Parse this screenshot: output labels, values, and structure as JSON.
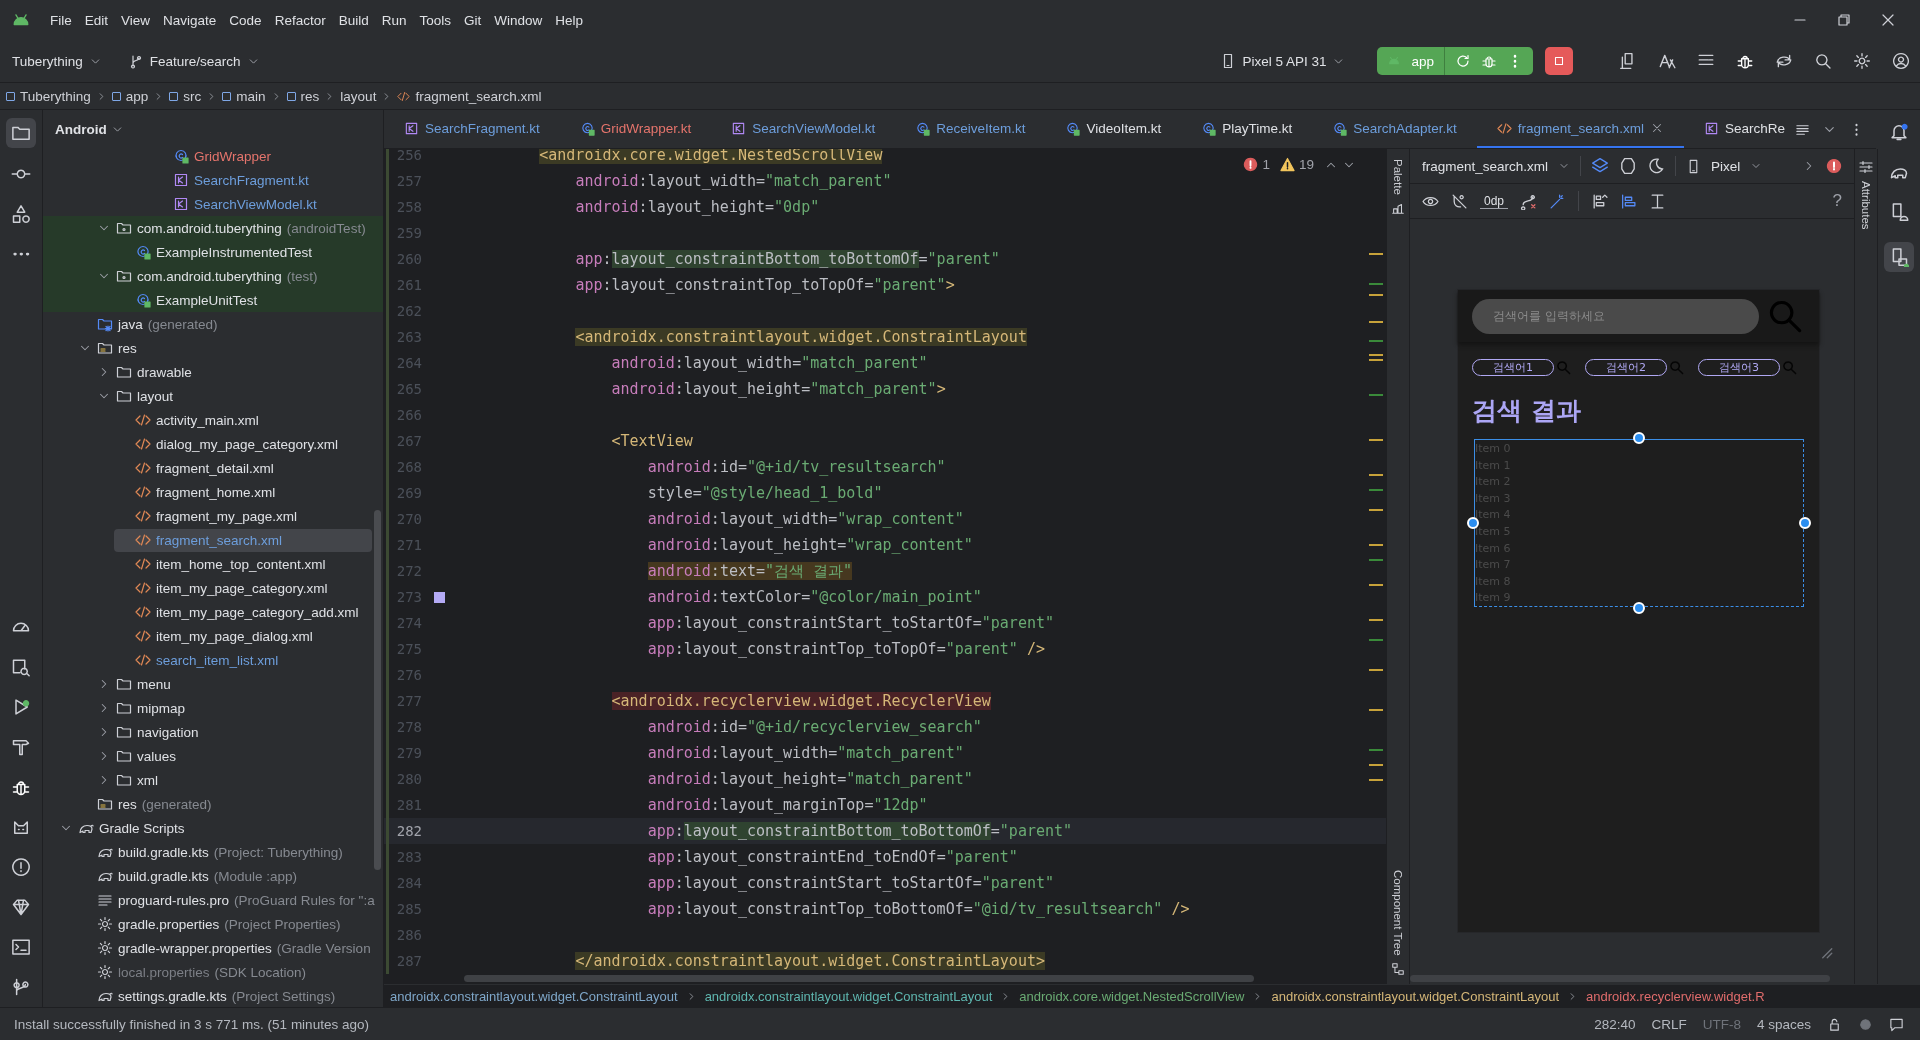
{
  "menu": [
    "File",
    "Edit",
    "View",
    "Navigate",
    "Code",
    "Refactor",
    "Build",
    "Run",
    "Tools",
    "Git",
    "Window",
    "Help"
  ],
  "toolbar": {
    "project": "Tuberything",
    "branch": "Feature/search",
    "device": "Pixel 5 API 31",
    "run_config": "app"
  },
  "breadcrumb": [
    "Tuberything",
    "app",
    "src",
    "main",
    "res",
    "layout",
    "fragment_search.xml"
  ],
  "project_panel": {
    "view": "Android",
    "tree": [
      {
        "children": [
          {
            "children": [
              {
                "children": [
                  {
                    "children": [
                      {
                        "children": [
                          {
                            "label": "GridWrapper",
                            "kind": "class",
                            "color": "#e5746c",
                            "selected": false
                          },
                          {
                            "label": "SearchFragment.kt",
                            "kind": "kotlin",
                            "color": "#6d9edc",
                            "selected": false
                          },
                          {
                            "label": "SearchViewModel.kt",
                            "kind": "kotlin",
                            "color": "#6d9edc",
                            "selected": false
                          }
                        ]
                      }
                    ]
                  }
                ]
              },
              {
                "label": "com.android.tuberything",
                "suffix": "(androidTest)",
                "kind": "package",
                "selected": false,
                "highlighted": true,
                "expanded": true,
                "children": [
                  {
                    "label": "ExampleInstrumentedTest",
                    "kind": "class",
                    "selected": false,
                    "highlighted": true
                  }
                ]
              },
              {
                "label": "com.android.tuberything",
                "suffix": "(test)",
                "kind": "package",
                "selected": false,
                "highlighted": true,
                "expanded": true,
                "children": [
                  {
                    "label": "ExampleUnitTest",
                    "kind": "class",
                    "selected": false,
                    "highlighted": true
                  }
                ]
              }
            ]
          },
          {
            "label": "java",
            "suffix": "(generated)",
            "kind": "gen-folder",
            "selected": false
          },
          {
            "label": "res",
            "kind": "res-folder",
            "selected": false,
            "expanded": true,
            "children": [
              {
                "label": "drawable",
                "kind": "folder",
                "selected": false,
                "expanded": false
              },
              {
                "label": "layout",
                "kind": "folder",
                "selected": false,
                "expanded": true,
                "children": [
                  {
                    "label": "activity_main.xml",
                    "kind": "xml",
                    "selected": false
                  },
                  {
                    "label": "dialog_my_page_category.xml",
                    "kind": "xml",
                    "selected": false
                  },
                  {
                    "label": "fragment_detail.xml",
                    "kind": "xml",
                    "selected": false
                  },
                  {
                    "label": "fragment_home.xml",
                    "kind": "xml",
                    "selected": false
                  },
                  {
                    "label": "fragment_my_page.xml",
                    "kind": "xml",
                    "selected": false
                  },
                  {
                    "label": "fragment_search.xml",
                    "kind": "xml",
                    "color": "#6d9edc",
                    "selected": true
                  },
                  {
                    "label": "item_home_top_content.xml",
                    "kind": "xml",
                    "selected": false
                  },
                  {
                    "label": "item_my_page_category.xml",
                    "kind": "xml",
                    "selected": false
                  },
                  {
                    "label": "item_my_page_category_add.xml",
                    "kind": "xml",
                    "selected": false
                  },
                  {
                    "label": "item_my_page_dialog.xml",
                    "kind": "xml",
                    "selected": false
                  },
                  {
                    "label": "search_item_list.xml",
                    "kind": "xml",
                    "color": "#6d9edc",
                    "selected": false
                  }
                ]
              },
              {
                "label": "menu",
                "kind": "folder",
                "selected": false,
                "expanded": false
              },
              {
                "label": "mipmap",
                "kind": "folder",
                "selected": false,
                "expanded": false
              },
              {
                "label": "navigation",
                "kind": "folder",
                "selected": false,
                "expanded": false
              },
              {
                "label": "values",
                "kind": "folder",
                "selected": false,
                "expanded": false
              },
              {
                "label": "xml",
                "kind": "folder",
                "selected": false,
                "expanded": false
              }
            ]
          },
          {
            "label": "res",
            "suffix": "(generated)",
            "kind": "res-folder",
            "selected": false
          }
        ]
      },
      {
        "label": "Gradle Scripts",
        "kind": "gradle",
        "selected": false,
        "expanded": true,
        "children": [
          {
            "label": "build.gradle.kts",
            "suffix": "(Project: Tuberything)",
            "kind": "gradle",
            "selected": false
          },
          {
            "label": "build.gradle.kts",
            "suffix": "(Module :app)",
            "kind": "gradle",
            "selected": false
          },
          {
            "label": "proguard-rules.pro",
            "suffix": "(ProGuard Rules for \":a",
            "kind": "lines",
            "selected": false
          },
          {
            "label": "gradle.properties",
            "suffix": "(Project Properties)",
            "kind": "gear",
            "selected": false
          },
          {
            "label": "gradle-wrapper.properties",
            "suffix": "(Gradle Version",
            "kind": "gear",
            "selected": false
          },
          {
            "label": "local.properties",
            "suffix": "(SDK Location)",
            "kind": "gear",
            "color": "#7c7f86",
            "selected": false
          },
          {
            "label": "settings.gradle.kts",
            "suffix": "(Project Settings)",
            "kind": "gradle",
            "selected": false
          }
        ]
      }
    ]
  },
  "editor_tabs": [
    {
      "label": "SearchFragment.kt",
      "kind": "kotlin",
      "color": "#6d9edc",
      "selected": false
    },
    {
      "label": "GridWrapper.kt",
      "kind": "class",
      "color": "#e5746c",
      "selected": false
    },
    {
      "label": "SearchViewModel.kt",
      "kind": "kotlin",
      "color": "#6d9edc",
      "selected": false
    },
    {
      "label": "ReceiveItem.kt",
      "kind": "class",
      "color": "#6d9edc",
      "selected": false
    },
    {
      "label": "VideoItem.kt",
      "kind": "class",
      "color": "#dfe1e5",
      "selected": false
    },
    {
      "label": "PlayTime.kt",
      "kind": "class",
      "color": "#dfe1e5",
      "selected": false
    },
    {
      "label": "SearchAdapter.kt",
      "kind": "class",
      "color": "#6d9edc",
      "selected": false
    },
    {
      "label": "fragment_search.xml",
      "kind": "xml",
      "color": "#6d9edc",
      "selected": true
    },
    {
      "label": "SearchRe",
      "kind": "kotlin",
      "color": "#dfe1e5",
      "selected": false
    }
  ],
  "inspections": {
    "errors": "1",
    "warnings": "19"
  },
  "code_lines": [
    {
      "n": "256",
      "code": "        <androidx.core.widget.NestedScrollView",
      "kind": "tag-warning",
      "selected": false
    },
    {
      "n": "257",
      "code": "            android:layout_width=\"match_parent\"",
      "kind": "plain",
      "selected": false
    },
    {
      "n": "258",
      "code": "            android:layout_height=\"0dp\"",
      "kind": "plain",
      "selected": false
    },
    {
      "n": "259",
      "selected": false
    },
    {
      "n": "260",
      "code": "            app:layout_constraintBottom_toBottomOf=\"parent\"",
      "kind": "usage",
      "selected": false
    },
    {
      "n": "261",
      "code": "            app:layout_constraintTop_toTopOf=\"parent\">",
      "kind": "plain",
      "selected": false
    },
    {
      "n": "262",
      "selected": false
    },
    {
      "n": "263",
      "code": "            <androidx.constraintlayout.widget.ConstraintLayout",
      "kind": "tag-warning",
      "selected": false
    },
    {
      "n": "264",
      "code": "                android:layout_width=\"match_parent\"",
      "kind": "plain",
      "selected": false
    },
    {
      "n": "265",
      "code": "                android:layout_height=\"match_parent\">",
      "kind": "plain",
      "selected": false
    },
    {
      "n": "266",
      "selected": false
    },
    {
      "n": "267",
      "code": "                <TextView",
      "kind": "plain",
      "selected": false
    },
    {
      "n": "268",
      "code": "                    android:id=\"@+id/tv_resultsearch\"",
      "kind": "plain",
      "selected": false
    },
    {
      "n": "269",
      "code": "                    style=\"@style/head_1_bold\"",
      "kind": "plain",
      "selected": false
    },
    {
      "n": "270",
      "code": "                    android:layout_width=\"wrap_content\"",
      "kind": "plain",
      "selected": false
    },
    {
      "n": "271",
      "code": "                    android:layout_height=\"wrap_content\"",
      "kind": "plain",
      "selected": false
    },
    {
      "n": "272",
      "code": "                    android:text=\"검색 결과\"",
      "kind": "text-warning",
      "selected": false
    },
    {
      "n": "273",
      "code": "                    android:textColor=\"@color/main_point\"",
      "kind": "plain",
      "selected": false,
      "color": "#b4aaf5"
    },
    {
      "n": "274",
      "code": "                    app:layout_constraintStart_toStartOf=\"parent\"",
      "kind": "plain",
      "selected": false
    },
    {
      "n": "275",
      "code": "                    app:layout_constraintTop_toTopOf=\"parent\" />",
      "kind": "plain",
      "selected": false
    },
    {
      "n": "276",
      "selected": false
    },
    {
      "n": "277",
      "code": "                <androidx.recyclerview.widget.RecyclerView",
      "kind": "tag-error",
      "selected": false
    },
    {
      "n": "278",
      "code": "                    android:id=\"@+id/recyclerview_search\"",
      "kind": "plain",
      "selected": false
    },
    {
      "n": "279",
      "code": "                    android:layout_width=\"match_parent\"",
      "kind": "plain",
      "selected": false
    },
    {
      "n": "280",
      "code": "                    android:layout_height=\"match_parent\"",
      "kind": "plain",
      "selected": false
    },
    {
      "n": "281",
      "code": "                    android:layout_marginTop=\"12dp\"",
      "kind": "plain",
      "selected": false
    },
    {
      "n": "282",
      "code": "                    app:layout_constraintBottom_toBottomOf=\"parent\"",
      "kind": "usage",
      "selected": true
    },
    {
      "n": "283",
      "code": "                    app:layout_constraintEnd_toEndOf=\"parent\"",
      "kind": "plain",
      "selected": false
    },
    {
      "n": "284",
      "code": "                    app:layout_constraintStart_toStartOf=\"parent\"",
      "kind": "plain",
      "selected": false
    },
    {
      "n": "285",
      "code": "                    app:layout_constraintTop_toBottomOf=\"@id/tv_resultsearch\" />",
      "kind": "plain",
      "selected": false
    },
    {
      "n": "286",
      "selected": false
    },
    {
      "n": "287",
      "code": "            </androidx.constraintlayout.widget.ConstraintLayout>",
      "kind": "tag-warning",
      "selected": false
    }
  ],
  "code_breadcrumb": [
    {
      "label": "androidx.constraintlayout.widget.ConstraintLayout",
      "color": "#7fa7c9"
    },
    {
      "label": "androidx.constraintlayout.widget.ConstraintLayout",
      "color": "#5fb7b0"
    },
    {
      "label": "androidx.core.widget.NestedScrollView",
      "color": "#6aab73"
    },
    {
      "label": "androidx.constraintlayout.widget.ConstraintLayout",
      "color": "#d5b778"
    },
    {
      "label": "androidx.recyclerview.widget.R",
      "color": "#e06c6c"
    }
  ],
  "design": {
    "file": "fragment_search.xml",
    "device": "Pixel",
    "margin": "0dp",
    "help": "?",
    "palette": "Palette",
    "component_tree": "Component Tree",
    "attributes": "Attributes",
    "preview": {
      "search_placeholder": "검색어를 입력하세요",
      "chips": [
        "검색어1",
        "검색어2",
        "검색어3"
      ],
      "title": "검색 결과",
      "items": [
        "Item 0",
        "Item 1",
        "Item 2",
        "Item 3",
        "Item 4",
        "Item 5",
        "Item 6",
        "Item 7",
        "Item 8",
        "Item 9"
      ]
    }
  },
  "status_bar": {
    "message": "Install successfully finished in 3 s 771 ms. (51 minutes ago)",
    "position": "282:40",
    "line_endings": "CRLF",
    "encoding": "UTF-8",
    "indent": "4 spaces"
  }
}
